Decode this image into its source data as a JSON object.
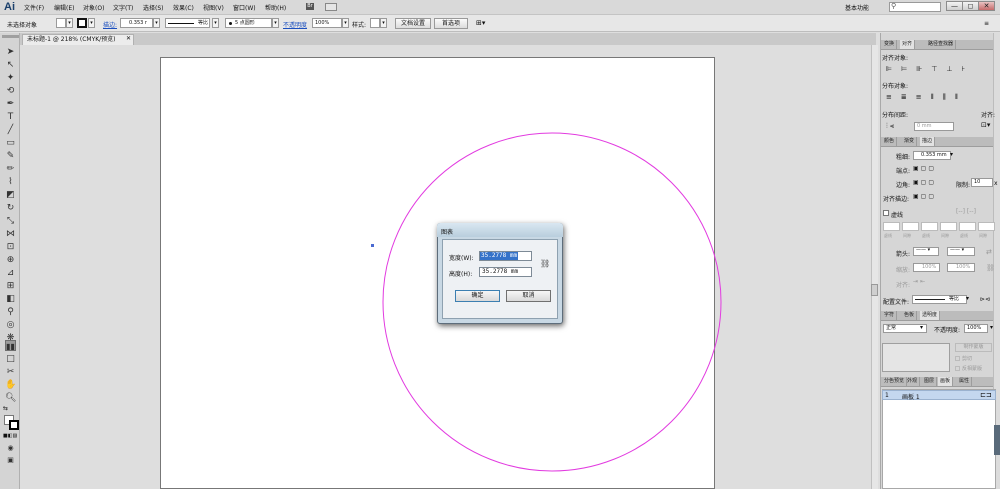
{
  "app": {
    "logo": "Ai",
    "workspace": "基本功能",
    "bridge": "Br"
  },
  "menu": [
    "文件(F)",
    "编辑(E)",
    "对象(O)",
    "文字(T)",
    "选择(S)",
    "效果(C)",
    "视图(V)",
    "窗口(W)",
    "帮助(H)"
  ],
  "window_controls": {
    "minimize": "—",
    "restore": "◻",
    "close": "✕"
  },
  "controlbar": {
    "selection": "未选择对象",
    "stroke_label": "描边:",
    "stroke_value": "0.353 r",
    "stroke_style": "等比",
    "brush": "5 点圆形",
    "opacity_label": "不透明度",
    "opacity_value": "100%",
    "style_label": "样式:",
    "doc_setup": "文档设置",
    "prefs": "首选项"
  },
  "tab": {
    "title": "未标题-1 @ 218% (CMYK/预览)",
    "close": "✕"
  },
  "dialog": {
    "title": "图表",
    "width_label": "宽度(W):",
    "width_value": "35.2778 mm",
    "height_label": "高度(H):",
    "height_value": "35.2778 mm",
    "ok": "确定",
    "cancel": "取消"
  },
  "align_panel": {
    "tabs": [
      "变换",
      "对齐",
      "路径查找器"
    ],
    "align_objects": "对齐对象:",
    "distribute_objects": "分布对象:",
    "distribute_spacing": "分布间距:",
    "spacing_value": "0 mm",
    "align_to": "对齐:"
  },
  "stroke_panel": {
    "tabs": [
      "颜色",
      "渐变",
      "描边"
    ],
    "weight_label": "粗细:",
    "weight_value": "0.353 mm",
    "cap_label": "端点:",
    "corner_label": "边角:",
    "limit_label": "限制:",
    "limit_value": "10",
    "limit_unit": "x",
    "align_stroke_label": "对齐描边:",
    "dashed_label": "虚线",
    "dash_labels": [
      "虚线",
      "间隙",
      "虚线",
      "间隙",
      "虚线",
      "间隙"
    ],
    "arrow_label": "箭头:",
    "scale_label": "缩放:",
    "scale_1": "100%",
    "scale_2": "100%",
    "align_label": "对齐:",
    "profile_label": "配置文件:",
    "profile_value": "等比"
  },
  "transparency_panel": {
    "tabs": [
      "字符",
      "色板",
      "透明度"
    ],
    "blend_mode": "正常",
    "opacity_label": "不透明度:",
    "opacity_value": "100%",
    "mask_button": "制作蒙版",
    "clip_label": "剪切",
    "invert_label": "反相蒙版"
  },
  "artboards_panel": {
    "tabs": [
      "分色预览",
      "外观",
      "图层",
      "画板",
      "属性"
    ],
    "rows": [
      {
        "index": "1",
        "name": "画板 1"
      }
    ]
  },
  "colors": {
    "circle": "#e23be0",
    "selection": "#3472c9"
  }
}
